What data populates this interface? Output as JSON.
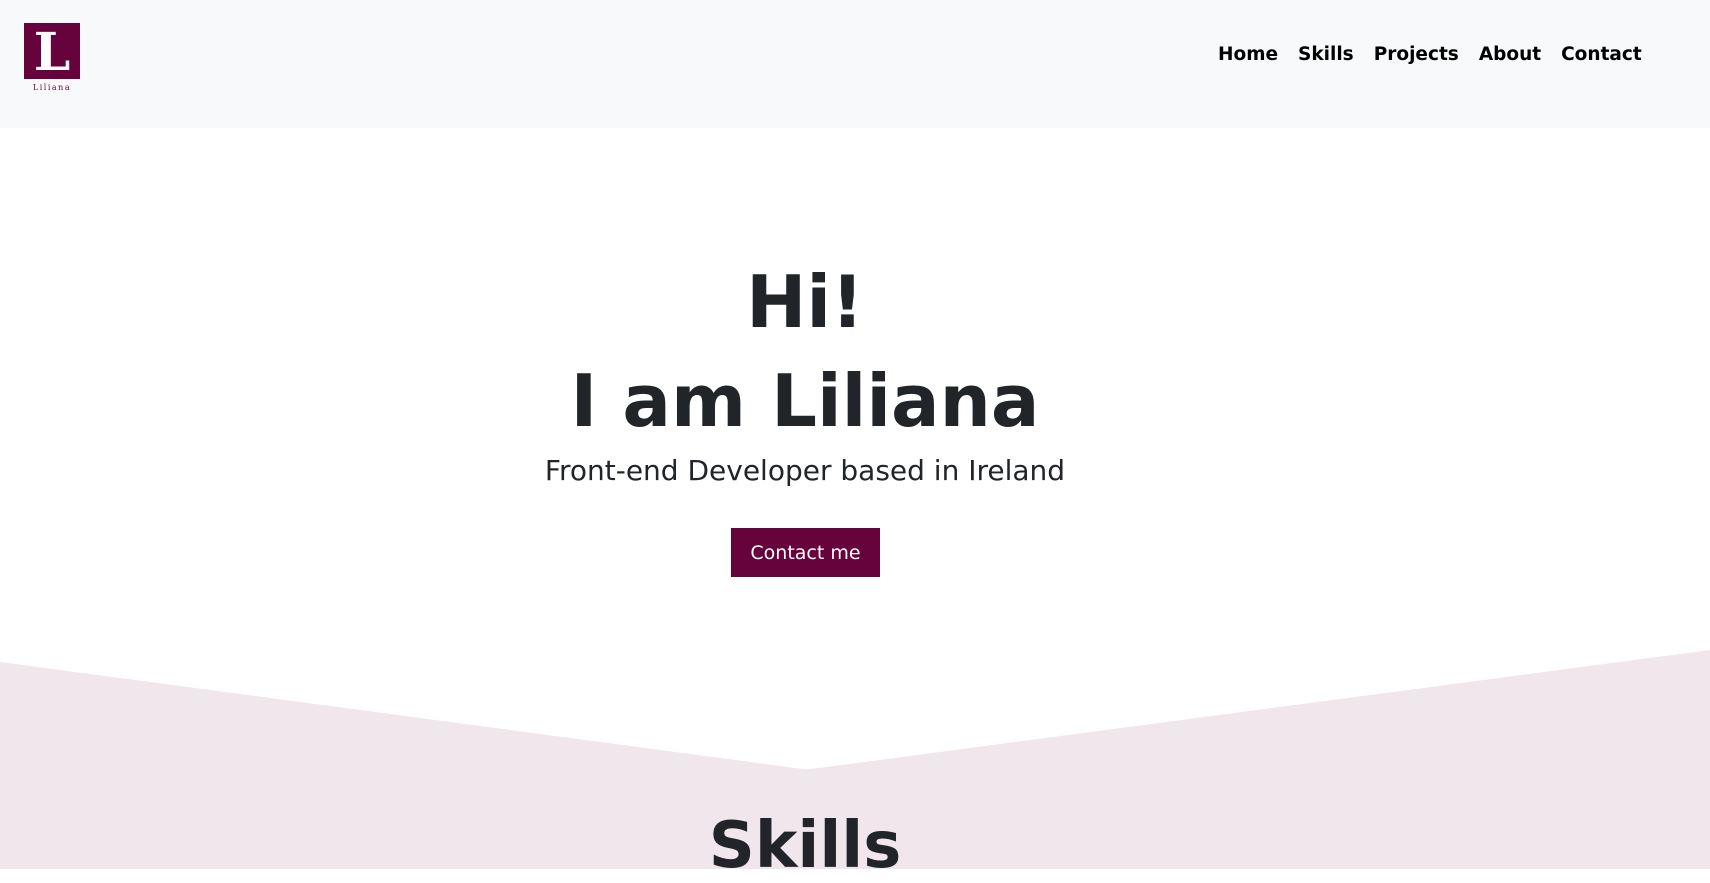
{
  "navbar": {
    "logo": {
      "letter": "L",
      "name": "Liliana"
    },
    "links": [
      {
        "label": "Home"
      },
      {
        "label": "Skills"
      },
      {
        "label": "Projects"
      },
      {
        "label": "About"
      },
      {
        "label": "Contact"
      }
    ]
  },
  "hero": {
    "greeting": "Hi!",
    "intro": "I am Liliana",
    "subtitle": "Front-end Developer based in Ireland",
    "cta_label": "Contact me"
  },
  "skills": {
    "title": "Skills"
  },
  "colors": {
    "brand": "#66023c",
    "navbar_bg": "#f8f9fa",
    "skills_bg": "#f0e6eb",
    "text": "#212529"
  }
}
